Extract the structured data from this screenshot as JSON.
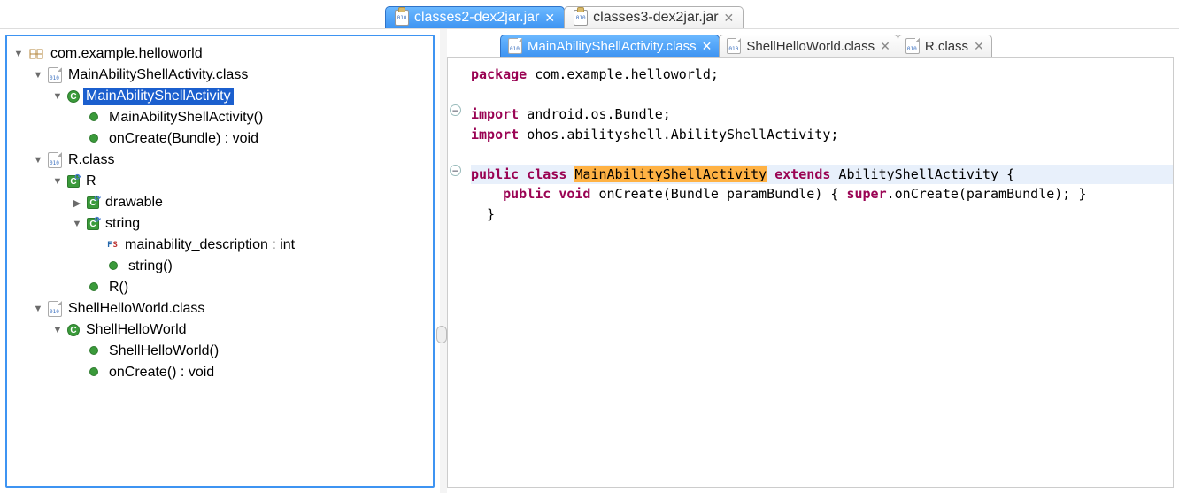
{
  "topTabs": [
    {
      "label": "classes2-dex2jar.jar",
      "active": true
    },
    {
      "label": "classes3-dex2jar.jar",
      "active": false
    }
  ],
  "tree": {
    "pkg": "com.example.helloworld",
    "node1": {
      "file": "MainAbilityShellActivity.class",
      "cls": "MainAbilityShellActivity",
      "ctor": "MainAbilityShellActivity()",
      "method": "onCreate(Bundle) : void"
    },
    "node2": {
      "file": "R.class",
      "cls": "R",
      "sub1": "drawable",
      "sub2": "string",
      "field": "mainability_description : int",
      "submethod": "string()",
      "rmethod": "R()"
    },
    "node3": {
      "file": "ShellHelloWorld.class",
      "cls": "ShellHelloWorld",
      "ctor": "ShellHelloWorld()",
      "method": "onCreate() : void"
    }
  },
  "editorTabs": [
    {
      "label": "MainAbilityShellActivity.class",
      "active": true
    },
    {
      "label": "ShellHelloWorld.class",
      "active": false
    },
    {
      "label": "R.class",
      "active": false
    }
  ],
  "code": {
    "pkg_kw": "package",
    "pkg_val": " com.example.helloworld;",
    "imp_kw": "import",
    "imp1": " android.os.Bundle;",
    "imp2": " ohos.abilityshell.AbilityShellActivity;",
    "public": "public",
    "class": "class",
    "classname": "MainAbilityShellActivity",
    "extends": "extends",
    "supercls": " AbilityShellActivity {",
    "void": "void",
    "sig": " onCreate(Bundle paramBundle) { ",
    "super": "super",
    "rest": ".onCreate(paramBundle); }",
    "close": "  }"
  }
}
